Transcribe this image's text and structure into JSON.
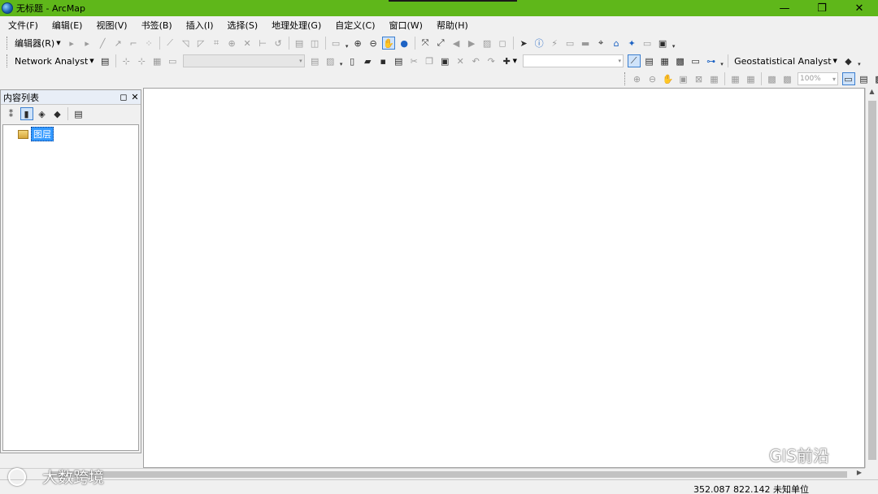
{
  "window": {
    "title": "无标题 - ArcMap",
    "controls": {
      "minimize": "—",
      "restore": "❐",
      "close": "✕"
    }
  },
  "menu": [
    "文件(F)",
    "编辑(E)",
    "视图(V)",
    "书签(B)",
    "插入(I)",
    "选择(S)",
    "地理处理(G)",
    "自定义(C)",
    "窗口(W)",
    "帮助(H)"
  ],
  "toolbar1": {
    "editor_label": "编辑器(R)"
  },
  "toolbar2": {
    "network_label": "Network Analyst",
    "geostat_label": "Geostatistical Analyst"
  },
  "toolbar3": {
    "zoom_value": "100%"
  },
  "toc": {
    "title": "内容列表",
    "layer_label": "图层"
  },
  "status": {
    "coords": "352.087  822.142 未知单位"
  },
  "watermarks": {
    "gis": "GIS前沿",
    "bottom": "大数跨境"
  },
  "colors": {
    "titlebar": "#5fb71a",
    "selection": "#3399ff"
  }
}
